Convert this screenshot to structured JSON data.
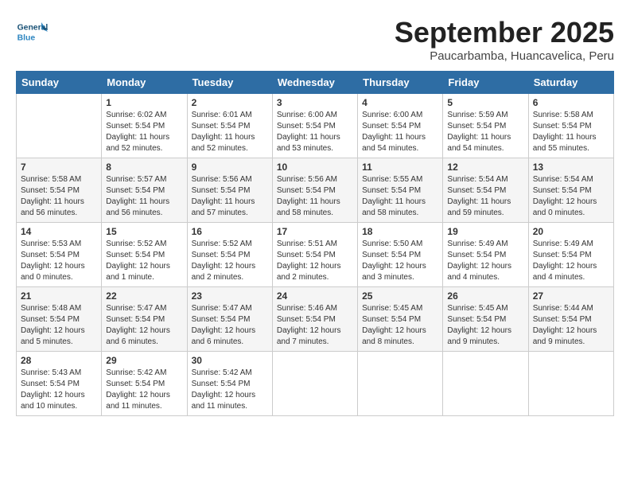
{
  "header": {
    "logo_general": "General",
    "logo_blue": "Blue",
    "month_title": "September 2025",
    "location": "Paucarbamba, Huancavelica, Peru"
  },
  "weekdays": [
    "Sunday",
    "Monday",
    "Tuesday",
    "Wednesday",
    "Thursday",
    "Friday",
    "Saturday"
  ],
  "weeks": [
    [
      {
        "day": null
      },
      {
        "day": 1,
        "sunrise": "6:02 AM",
        "sunset": "5:54 PM",
        "daylight": "11 hours and 52 minutes."
      },
      {
        "day": 2,
        "sunrise": "6:01 AM",
        "sunset": "5:54 PM",
        "daylight": "11 hours and 52 minutes."
      },
      {
        "day": 3,
        "sunrise": "6:00 AM",
        "sunset": "5:54 PM",
        "daylight": "11 hours and 53 minutes."
      },
      {
        "day": 4,
        "sunrise": "6:00 AM",
        "sunset": "5:54 PM",
        "daylight": "11 hours and 54 minutes."
      },
      {
        "day": 5,
        "sunrise": "5:59 AM",
        "sunset": "5:54 PM",
        "daylight": "11 hours and 54 minutes."
      },
      {
        "day": 6,
        "sunrise": "5:58 AM",
        "sunset": "5:54 PM",
        "daylight": "11 hours and 55 minutes."
      }
    ],
    [
      {
        "day": 7,
        "sunrise": "5:58 AM",
        "sunset": "5:54 PM",
        "daylight": "11 hours and 56 minutes."
      },
      {
        "day": 8,
        "sunrise": "5:57 AM",
        "sunset": "5:54 PM",
        "daylight": "11 hours and 56 minutes."
      },
      {
        "day": 9,
        "sunrise": "5:56 AM",
        "sunset": "5:54 PM",
        "daylight": "11 hours and 57 minutes."
      },
      {
        "day": 10,
        "sunrise": "5:56 AM",
        "sunset": "5:54 PM",
        "daylight": "11 hours and 58 minutes."
      },
      {
        "day": 11,
        "sunrise": "5:55 AM",
        "sunset": "5:54 PM",
        "daylight": "11 hours and 58 minutes."
      },
      {
        "day": 12,
        "sunrise": "5:54 AM",
        "sunset": "5:54 PM",
        "daylight": "11 hours and 59 minutes."
      },
      {
        "day": 13,
        "sunrise": "5:54 AM",
        "sunset": "5:54 PM",
        "daylight": "12 hours and 0 minutes."
      }
    ],
    [
      {
        "day": 14,
        "sunrise": "5:53 AM",
        "sunset": "5:54 PM",
        "daylight": "12 hours and 0 minutes."
      },
      {
        "day": 15,
        "sunrise": "5:52 AM",
        "sunset": "5:54 PM",
        "daylight": "12 hours and 1 minute."
      },
      {
        "day": 16,
        "sunrise": "5:52 AM",
        "sunset": "5:54 PM",
        "daylight": "12 hours and 2 minutes."
      },
      {
        "day": 17,
        "sunrise": "5:51 AM",
        "sunset": "5:54 PM",
        "daylight": "12 hours and 2 minutes."
      },
      {
        "day": 18,
        "sunrise": "5:50 AM",
        "sunset": "5:54 PM",
        "daylight": "12 hours and 3 minutes."
      },
      {
        "day": 19,
        "sunrise": "5:49 AM",
        "sunset": "5:54 PM",
        "daylight": "12 hours and 4 minutes."
      },
      {
        "day": 20,
        "sunrise": "5:49 AM",
        "sunset": "5:54 PM",
        "daylight": "12 hours and 4 minutes."
      }
    ],
    [
      {
        "day": 21,
        "sunrise": "5:48 AM",
        "sunset": "5:54 PM",
        "daylight": "12 hours and 5 minutes."
      },
      {
        "day": 22,
        "sunrise": "5:47 AM",
        "sunset": "5:54 PM",
        "daylight": "12 hours and 6 minutes."
      },
      {
        "day": 23,
        "sunrise": "5:47 AM",
        "sunset": "5:54 PM",
        "daylight": "12 hours and 6 minutes."
      },
      {
        "day": 24,
        "sunrise": "5:46 AM",
        "sunset": "5:54 PM",
        "daylight": "12 hours and 7 minutes."
      },
      {
        "day": 25,
        "sunrise": "5:45 AM",
        "sunset": "5:54 PM",
        "daylight": "12 hours and 8 minutes."
      },
      {
        "day": 26,
        "sunrise": "5:45 AM",
        "sunset": "5:54 PM",
        "daylight": "12 hours and 9 minutes."
      },
      {
        "day": 27,
        "sunrise": "5:44 AM",
        "sunset": "5:54 PM",
        "daylight": "12 hours and 9 minutes."
      }
    ],
    [
      {
        "day": 28,
        "sunrise": "5:43 AM",
        "sunset": "5:54 PM",
        "daylight": "12 hours and 10 minutes."
      },
      {
        "day": 29,
        "sunrise": "5:42 AM",
        "sunset": "5:54 PM",
        "daylight": "12 hours and 11 minutes."
      },
      {
        "day": 30,
        "sunrise": "5:42 AM",
        "sunset": "5:54 PM",
        "daylight": "12 hours and 11 minutes."
      },
      {
        "day": null
      },
      {
        "day": null
      },
      {
        "day": null
      },
      {
        "day": null
      }
    ]
  ],
  "labels": {
    "sunrise": "Sunrise:",
    "sunset": "Sunset:",
    "daylight": "Daylight:"
  }
}
